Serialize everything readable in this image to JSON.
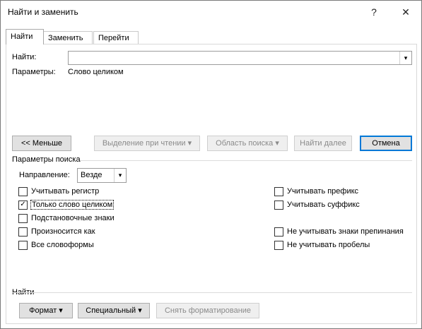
{
  "window": {
    "title": "Найти и заменить",
    "help_glyph": "?",
    "close_glyph": "✕"
  },
  "tabs": [
    {
      "label": "Найти",
      "active": true
    },
    {
      "label": "Заменить",
      "active": false
    },
    {
      "label": "Перейти",
      "active": false
    }
  ],
  "find": {
    "label": "Найти:",
    "value": "",
    "params_label": "Параметры:",
    "params_value": "Слово целиком"
  },
  "buttons": {
    "less": "<< Меньше",
    "reading_highlight": "Выделение при чтении",
    "search_area": "Область поиска",
    "find_next": "Найти далее",
    "cancel": "Отмена"
  },
  "search_options": {
    "section_label": "Параметры поиска",
    "direction_label": "Направление:",
    "direction_value": "Везде",
    "left": [
      {
        "label": "Учитывать регистр",
        "checked": false
      },
      {
        "label": "Только слово целиком",
        "checked": true
      },
      {
        "label": "Подстановочные знаки",
        "checked": false
      },
      {
        "label": "Произносится как",
        "checked": false
      },
      {
        "label": "Все словоформы",
        "checked": false
      }
    ],
    "right": [
      {
        "label": "Учитывать префикс",
        "checked": false
      },
      {
        "label": "Учитывать суффикс",
        "checked": false
      },
      {
        "label": "Не учитывать знаки препинания",
        "checked": false
      },
      {
        "label": "Не учитывать пробелы",
        "checked": false
      }
    ]
  },
  "find_section": {
    "label": "Найти",
    "format": "Формат",
    "special": "Специальный",
    "clear_formatting": "Снять форматирование"
  },
  "icons": {
    "dropdown": "chevron-down-icon",
    "check": "check-icon"
  }
}
